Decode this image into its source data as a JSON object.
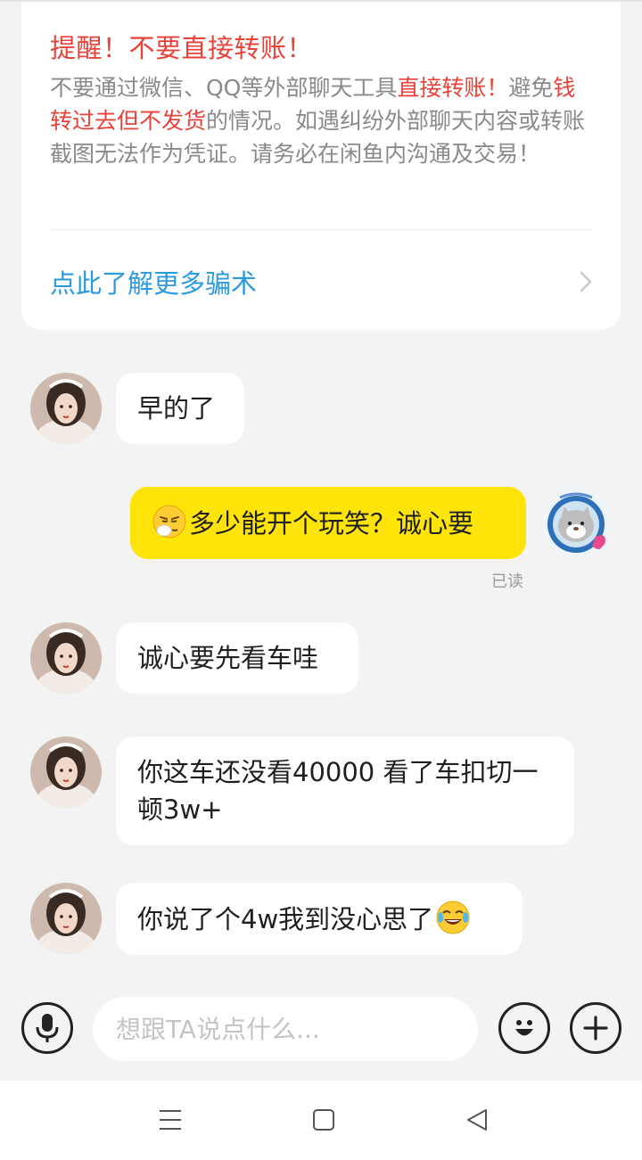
{
  "warning": {
    "title": "提醒！不要直接转账！",
    "body_1": "不要通过微信、QQ等外部聊天工具",
    "body_red_1": "直接转账！",
    "body_2": "避免",
    "body_red_2": "钱转过去但不发货",
    "body_3": "的情况。如遇纠纷外部聊天内容或转账截图无法作为凭证。请务必在闲鱼内沟通及交易！",
    "learn_more": "点此了解更多骗术",
    "colors": {
      "alert": "#e8433a",
      "link": "#2b9ae0"
    }
  },
  "messages": [
    {
      "side": "left",
      "text": "早的了"
    },
    {
      "side": "right",
      "emoji": "sneezing-face",
      "text": "多少能开个玩笑？诚心要",
      "status": "已读"
    },
    {
      "side": "left",
      "text": "诚心要先看车哇"
    },
    {
      "side": "left",
      "text": "你这车还没看40000  看了车扣切一顿3w+"
    },
    {
      "side": "left",
      "text": "你说了个4w我到没心思了",
      "emoji": "rolling-on-floor-laughing"
    }
  ],
  "input": {
    "placeholder": "想跟TA说点什么..."
  },
  "icons": {
    "voice": "microphone-icon",
    "emoji": "smiley-icon",
    "more": "plus-icon",
    "nav_menu": "menu-icon",
    "nav_home": "home-square-icon",
    "nav_back": "back-triangle-icon"
  },
  "colors": {
    "background": "#f3f3f3",
    "my_bubble": "#ffe40a",
    "their_bubble": "#ffffff"
  }
}
